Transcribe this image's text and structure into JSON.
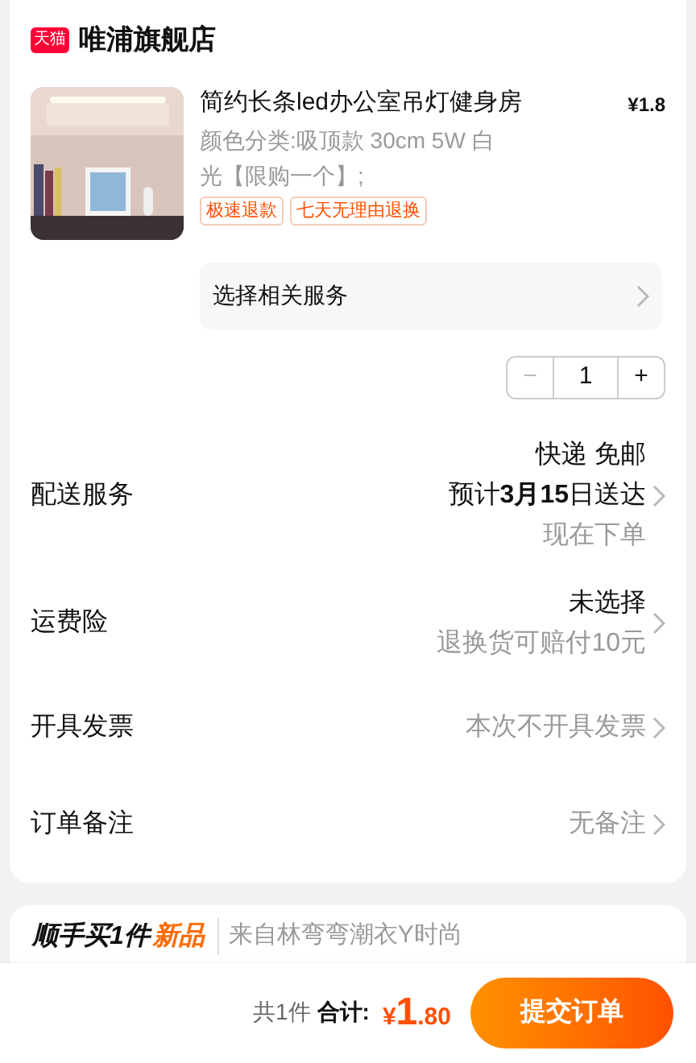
{
  "store": {
    "badge": "天猫",
    "name": "唯浦旗舰店"
  },
  "product": {
    "image": {
      "kind": "picture"
    },
    "title": "简约长条led办公室吊灯健身房",
    "price": "¥1.8",
    "variant": "颜色分类:吸顶款 30cm 5W 白光【限购一个】;",
    "tags": [
      "极速退款",
      "七天无理由退换"
    ],
    "services": "选择相关服务",
    "quantity": "1",
    "minus": "−",
    "plus": "+"
  },
  "rows": [
    {
      "label": "配送服务",
      "lines": [
        {
          "text": "快递 免邮",
          "kind": "strong"
        },
        {
          "text": "预计**3月15**日送达",
          "kind": "strong"
        },
        {
          "text": "现在下单",
          "kind": "muted"
        }
      ]
    },
    {
      "label": "运费险",
      "lines": [
        {
          "text": "未选择",
          "kind": "strong"
        },
        {
          "text": "退换货可赔付10元",
          "kind": "muted"
        }
      ]
    },
    {
      "label": "开具发票",
      "lines": [
        {
          "text": "本次不开具发票",
          "kind": "muted"
        }
      ]
    },
    {
      "label": "订单备注",
      "lines": [
        {
          "text": "无备注",
          "kind": "muted"
        }
      ]
    }
  ],
  "upsell": {
    "title": "顺手买1件",
    "badge": "新品",
    "source": "来自林弯弯潮衣Y时尚"
  },
  "footer": {
    "count": "共1件",
    "total_label": "合计:",
    "total": "¥1.80",
    "submit": "提交订单"
  }
}
